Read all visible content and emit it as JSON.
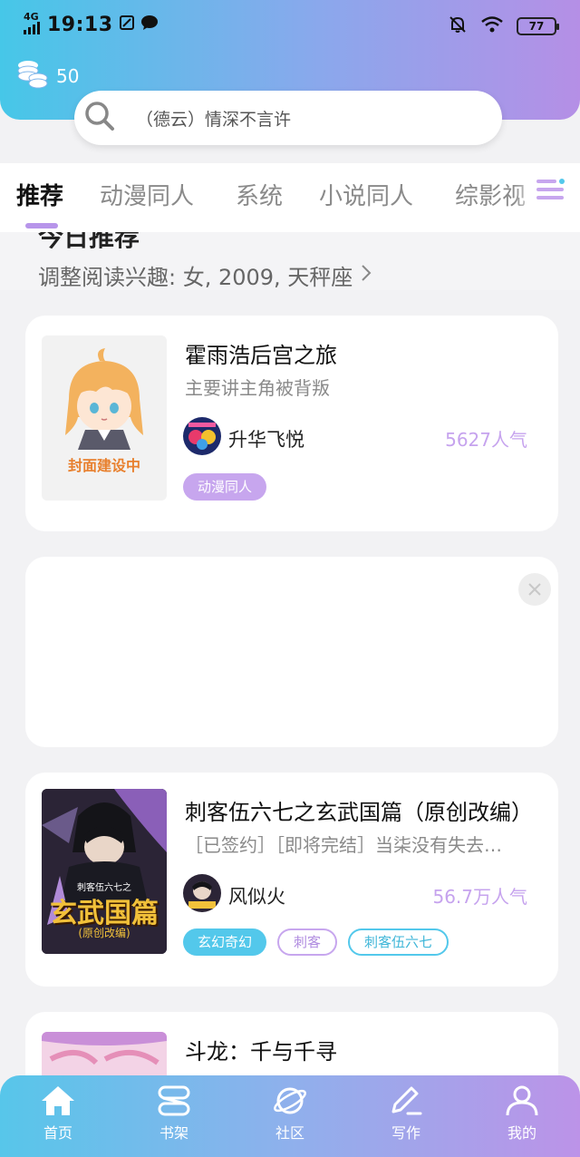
{
  "status": {
    "network": "4G",
    "time": "19:13",
    "battery": "77"
  },
  "coins": {
    "count": "50"
  },
  "search": {
    "placeholder": "（德云）情深不言许"
  },
  "tabs": [
    {
      "label": "推荐"
    },
    {
      "label": "动漫同人"
    },
    {
      "label": "系统"
    },
    {
      "label": "小说同人"
    },
    {
      "label": "综影视"
    }
  ],
  "today": {
    "title": "今日推荐",
    "subtitle": "调整阅读兴趣: 女, 2009, 天秤座"
  },
  "books": [
    {
      "title": "霍雨浩后宫之旅",
      "desc": "主要讲主角被背叛",
      "cover_text": "封面建设中",
      "author": "升华飞悦",
      "popularity": "5627人气",
      "tags": [
        "动漫同人"
      ]
    },
    {
      "title": "刺客伍六七之玄武国篇（原创改编）",
      "desc": "［已签约］［即将完结］当柒没有失去…",
      "cover_title": "玄武国篇",
      "cover_subtitle": "(原创改编)",
      "cover_top": "刺客伍六七之",
      "author": "风似火",
      "popularity": "56.7万人气",
      "tags": [
        "玄幻奇幻",
        "刺客",
        "刺客伍六七"
      ]
    },
    {
      "title": "斗龙：千与千寻"
    }
  ],
  "nav": [
    {
      "label": "首页"
    },
    {
      "label": "书架"
    },
    {
      "label": "社区"
    },
    {
      "label": "写作"
    },
    {
      "label": "我的"
    }
  ],
  "colors": {
    "header_start": "#46c7e8",
    "header_end": "#b58fe6",
    "accent_purple": "#c7a6ee",
    "accent_cyan": "#53c8eb"
  }
}
